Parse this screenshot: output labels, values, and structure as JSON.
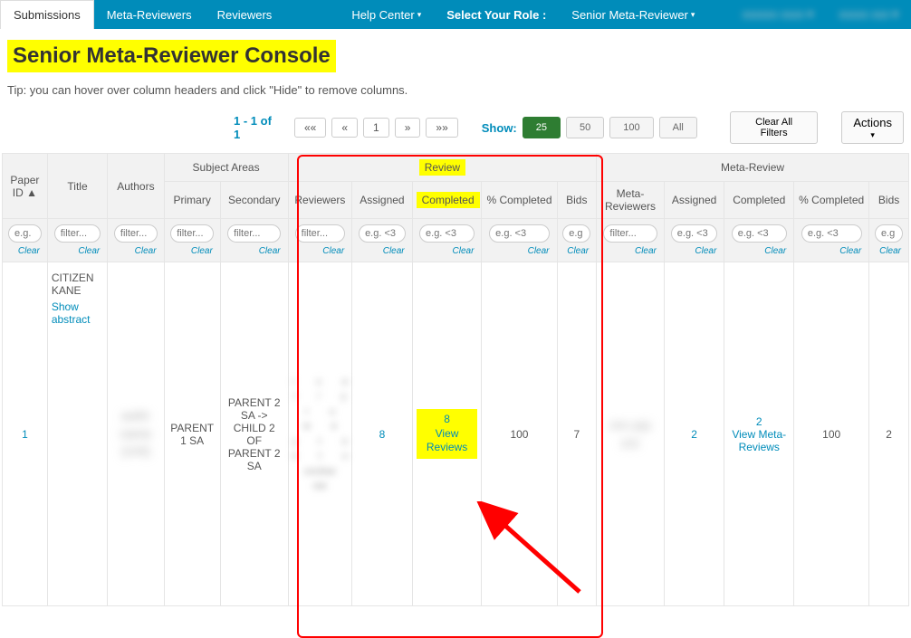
{
  "nav": {
    "tabs": [
      "Submissions",
      "Meta-Reviewers",
      "Reviewers"
    ],
    "help": "Help Center",
    "select_role_label": "Select Your Role :",
    "role": "Senior Meta-Reviewer",
    "user_a": "",
    "user_b": ""
  },
  "page": {
    "title": "Senior Meta-Reviewer Console",
    "tip": "Tip: you can hover over column headers and click \"Hide\" to remove columns."
  },
  "toolbar": {
    "range": "1 - 1 of 1",
    "pager": {
      "first": "««",
      "prev": "«",
      "page": "1",
      "next": "»",
      "last": "»»"
    },
    "show_label": "Show:",
    "counts": [
      "25",
      "50",
      "100",
      "All"
    ],
    "clear_all": "Clear All Filters",
    "actions": "Actions"
  },
  "headers": {
    "paper_id": "Paper ID",
    "title": "Title",
    "authors": "Authors",
    "subject_areas": "Subject Areas",
    "primary": "Primary",
    "secondary": "Secondary",
    "review": "Review",
    "reviewers": "Reviewers",
    "assigned": "Assigned",
    "completed": "Completed",
    "pct_completed": "% Completed",
    "bids": "Bids",
    "meta_review": "Meta-Review",
    "meta_reviewers": "Meta-Reviewers"
  },
  "filters": {
    "paper_id": "e.g.",
    "title": "filter...",
    "authors": "filter...",
    "primary": "filter...",
    "secondary": "filter...",
    "reviewers": "filter...",
    "assigned": "e.g. <3",
    "completed": "e.g. <3",
    "pct": "e.g. <3",
    "bids": "e.g",
    "meta_reviewers": "filter...",
    "m_assigned": "e.g. <3",
    "m_completed": "e.g. <3",
    "m_pct": "e.g. <3",
    "m_bids": "e.g",
    "clear": "Clear"
  },
  "row": {
    "id": "1",
    "title": "CITIZEN KANE",
    "show_abstract": "Show abstract",
    "authors_blur": "authr name (cmt)",
    "primary": "PARENT 1 SA",
    "secondary": "PARENT 2 SA -> CHILD 2 OF PARENT 2 SA",
    "reviewers_blur": "r x e t / y r u w e y t o e t u unclear oar",
    "assigned": "8",
    "completed_count": "8",
    "view_reviews": "View Reviews",
    "pct": "100",
    "bids": "7",
    "meta_reviewers_blur": "xxx yyy zzz",
    "m_assigned": "2",
    "m_completed_count": "2",
    "view_meta_reviews": "View Meta-Reviews",
    "m_pct": "100",
    "m_bids": "2"
  }
}
